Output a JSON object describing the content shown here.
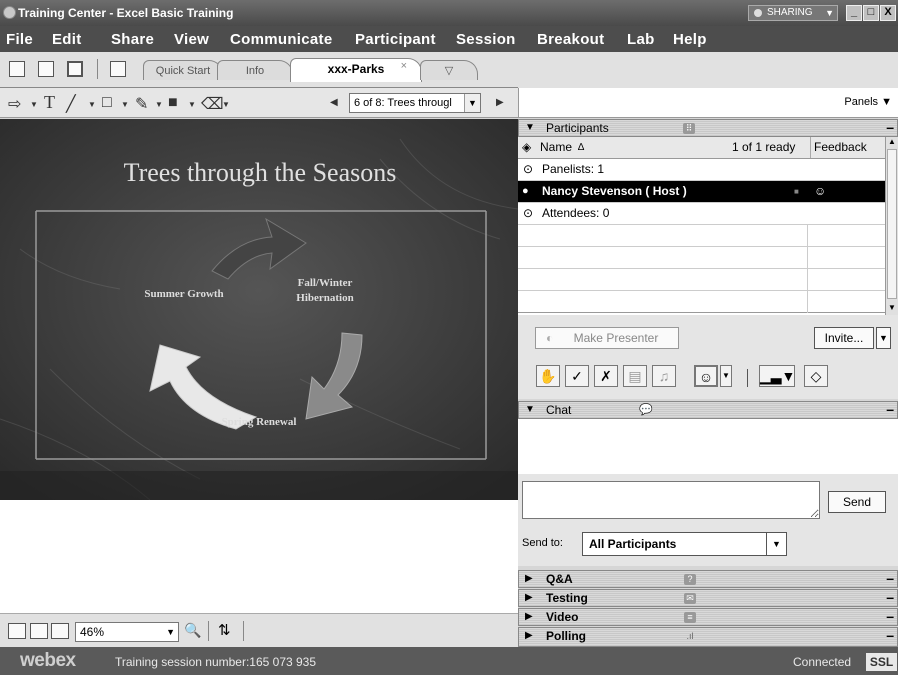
{
  "window": {
    "title": "Training Center - Excel Basic Training",
    "sharing_label": "SHARING",
    "min": "_",
    "max": "□",
    "close": "X"
  },
  "menu": [
    "File",
    "Edit",
    "Share",
    "View",
    "Communicate",
    "Participant",
    "Session",
    "Breakout",
    "Lab",
    "Help"
  ],
  "tabs": {
    "quick_start": "Quick Start",
    "info": "Info",
    "doc": "xxx-Parks",
    "close_glyph": "×",
    "more_glyph": "▽"
  },
  "annotation": {
    "page_selector": "6 of 8: Trees througl",
    "prev_glyph": "◀",
    "next_glyph": "▶"
  },
  "slide": {
    "title": "Trees through the Seasons",
    "label_summer": "Summer Growth",
    "label_fall_line1": "Fall/Winter",
    "label_fall_line2": "Hibernation",
    "label_spring": "Spring Renewal"
  },
  "left_bottom": {
    "zoom": "46%"
  },
  "panels_button": "Panels",
  "participants": {
    "header": "Participants",
    "col_name": "Name",
    "sort_glyph": "∆",
    "ready": "1 of 1 ready",
    "col_feedback": "Feedback",
    "panelists": "Panelists: 1",
    "host": "Nancy Stevenson ( Host )",
    "attendees": "Attendees: 0",
    "make_presenter": "Make Presenter",
    "invite": "Invite..."
  },
  "chat": {
    "header": "Chat",
    "send": "Send",
    "send_to_label": "Send to:",
    "send_to_value": "All Participants"
  },
  "collapsed_panels": [
    {
      "label": "Q&A",
      "icon": "?"
    },
    {
      "label": "Testing",
      "icon": "✉"
    },
    {
      "label": "Video",
      "icon": "≡"
    },
    {
      "label": "Polling",
      "icon": ".ıl"
    }
  ],
  "status": {
    "logo": "webex",
    "session_text": "Training session number:165 073 935",
    "connected": "Connected",
    "ssl": "SSL"
  },
  "colors": {
    "title_bar": "#4a4a4a",
    "menu_bar": "#4d4d4d",
    "slide_bg": "#3a3a3a",
    "host_row": "#000000",
    "status_bar": "#5a5a5a"
  }
}
